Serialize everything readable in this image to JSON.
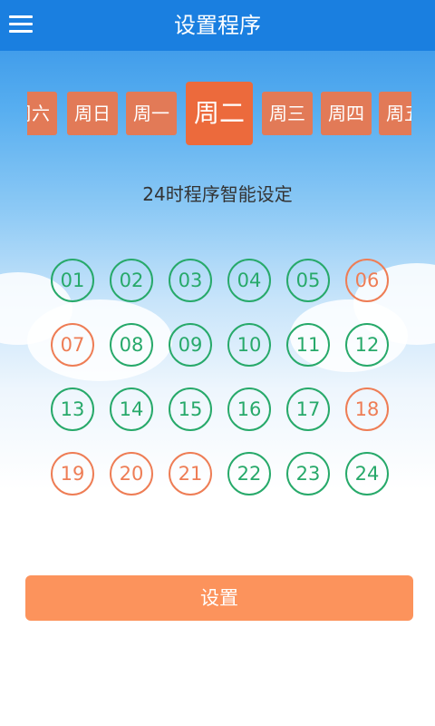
{
  "header": {
    "title": "设置程序",
    "menu_icon": "hamburger-menu-icon"
  },
  "days": [
    {
      "label": "周六",
      "selected": false
    },
    {
      "label": "周日",
      "selected": false
    },
    {
      "label": "周一",
      "selected": false
    },
    {
      "label": "周二",
      "selected": true
    },
    {
      "label": "周三",
      "selected": false
    },
    {
      "label": "周四",
      "selected": false
    },
    {
      "label": "周五",
      "selected": false
    }
  ],
  "subtitle": "24时程序智能设定",
  "hours": [
    {
      "label": "01",
      "active": false
    },
    {
      "label": "02",
      "active": false
    },
    {
      "label": "03",
      "active": false
    },
    {
      "label": "04",
      "active": false
    },
    {
      "label": "05",
      "active": false
    },
    {
      "label": "06",
      "active": true
    },
    {
      "label": "07",
      "active": true
    },
    {
      "label": "08",
      "active": false
    },
    {
      "label": "09",
      "active": false
    },
    {
      "label": "10",
      "active": false
    },
    {
      "label": "11",
      "active": false
    },
    {
      "label": "12",
      "active": false
    },
    {
      "label": "13",
      "active": false
    },
    {
      "label": "14",
      "active": false
    },
    {
      "label": "15",
      "active": false
    },
    {
      "label": "16",
      "active": false
    },
    {
      "label": "17",
      "active": false
    },
    {
      "label": "18",
      "active": true
    },
    {
      "label": "19",
      "active": true
    },
    {
      "label": "20",
      "active": true
    },
    {
      "label": "21",
      "active": true
    },
    {
      "label": "22",
      "active": false
    },
    {
      "label": "23",
      "active": false
    },
    {
      "label": "24",
      "active": false
    }
  ],
  "button": {
    "label": "设置"
  },
  "colors": {
    "header_bg": "#1a7fe0",
    "day_tab": "#e27a57",
    "day_tab_selected": "#ec6a3c",
    "hour_inactive": "#27a96a",
    "hour_active": "#ee7d55",
    "button_bg": "#fc935c"
  }
}
